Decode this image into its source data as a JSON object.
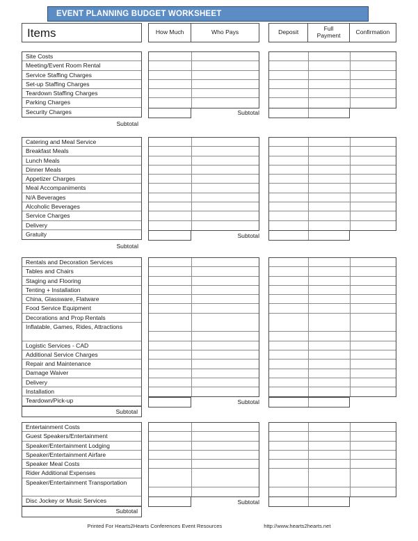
{
  "banner": {
    "title": "EVENT PLANNING BUDGET WORKSHEET",
    "color": "#5b8cc4"
  },
  "header": {
    "items_label": "Items",
    "columns_left": [
      "How Much",
      "Who Pays"
    ],
    "columns_right": [
      "Deposit",
      "Full\nPayment",
      "Confirmation"
    ],
    "deposit": "Deposit",
    "full_payment_line1": "Full",
    "full_payment_line2": "Payment",
    "confirmation": "Confirmation",
    "how_much": "How Much",
    "who_pays": "Who Pays"
  },
  "subtotal_label": "Subtotal",
  "sections": [
    {
      "title": "Site Costs",
      "rows": [
        {
          "label": "Meeting/Event Room Rental",
          "tall": false
        },
        {
          "label": "Service Staffing Charges",
          "tall": false
        },
        {
          "label": "Set-up Staffing Charges",
          "tall": false
        },
        {
          "label": "Teardown Staffing Charges",
          "tall": false
        },
        {
          "label": "Parking Charges",
          "tall": false
        },
        {
          "label": "Security Charges",
          "tall": false
        }
      ],
      "subtotal_boxed": false
    },
    {
      "title": "Catering and Meal Service",
      "rows": [
        {
          "label": "Breakfast Meals",
          "tall": false
        },
        {
          "label": "Lunch Meals",
          "tall": false
        },
        {
          "label": "Dinner Meals",
          "tall": false
        },
        {
          "label": "Appetizer Charges",
          "tall": false
        },
        {
          "label": "Meal Accompaniments",
          "tall": false
        },
        {
          "label": "N/A Beverages",
          "tall": false
        },
        {
          "label": "Alcoholic Beverages",
          "tall": false
        },
        {
          "label": "Service Charges",
          "tall": false
        },
        {
          "label": "Delivery",
          "tall": false
        },
        {
          "label": "Gratuity",
          "tall": false
        }
      ],
      "subtotal_boxed": false
    },
    {
      "title": "Rentals and Decoration Services",
      "rows": [
        {
          "label": "Tables and Chairs",
          "tall": false
        },
        {
          "label": "Staging and Flooring",
          "tall": false
        },
        {
          "label": "Tenting + Installation",
          "tall": false
        },
        {
          "label": "China, Glassware, Flatware",
          "tall": false
        },
        {
          "label": "Food Service Equipment",
          "tall": false
        },
        {
          "label": "Decorations and Prop Rentals",
          "tall": false
        },
        {
          "label": "Inflatable, Games, Rides, Attractions",
          "tall": true
        },
        {
          "label": "Logistic Services - CAD",
          "tall": false
        },
        {
          "label": "Additional Service Charges",
          "tall": false
        },
        {
          "label": "Repair and Maintenance",
          "tall": false
        },
        {
          "label": "Damage Waiver",
          "tall": false
        },
        {
          "label": "Delivery",
          "tall": false
        },
        {
          "label": "Installation",
          "tall": false
        },
        {
          "label": "Teardown/Pick-up",
          "tall": false
        }
      ],
      "subtotal_boxed": true
    },
    {
      "title": "Entertainment Costs",
      "rows": [
        {
          "label": "Guest Speakers/Entertainment",
          "tall": false
        },
        {
          "label": "Speaker/Entertainment Lodging",
          "tall": false
        },
        {
          "label": "Speaker/Entertainment Airfare",
          "tall": false
        },
        {
          "label": "Speaker Meal Costs",
          "tall": false
        },
        {
          "label": "Rider Additional Expenses",
          "tall": false
        },
        {
          "label": "Speaker/Entertainment Transportation",
          "tall": true
        },
        {
          "label": "Disc Jockey or Music Services",
          "tall": false
        }
      ],
      "subtotal_boxed": true
    }
  ],
  "footer": {
    "printed_for": "Printed For Hearts2Hearts Conferences Event Resources",
    "website": "http://www.hearts2hearts.net"
  }
}
